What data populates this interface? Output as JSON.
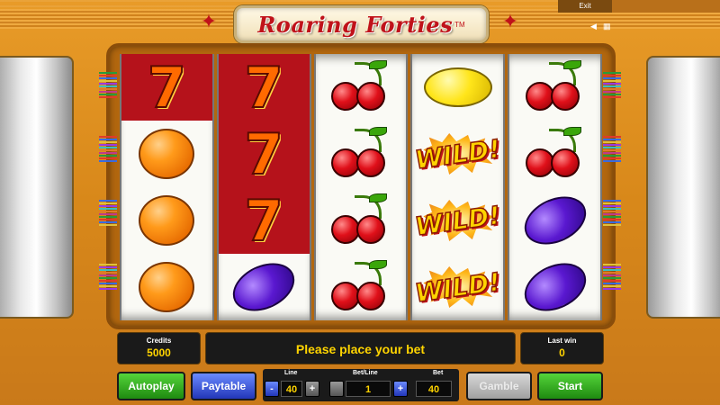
{
  "header": {
    "logo_text": "Roaring Forties",
    "trademark": "TM",
    "exit_label": "Exit"
  },
  "reels": [
    [
      "seven",
      "orange",
      "orange",
      "orange"
    ],
    [
      "seven",
      "seven",
      "seven",
      "plum"
    ],
    [
      "cherries",
      "cherries",
      "cherries",
      "cherries"
    ],
    [
      "lemon",
      "wild",
      "wild",
      "wild"
    ],
    [
      "cherries",
      "cherries",
      "plum",
      "plum"
    ]
  ],
  "symbols": {
    "wild_text": "WILD!"
  },
  "info": {
    "credits_label": "Credits",
    "credits_value": "5000",
    "message": "Please place your bet",
    "last_win_label": "Last win",
    "last_win_value": "0"
  },
  "controls": {
    "autoplay_label": "Autoplay",
    "paytable_label": "Paytable",
    "line_label": "Line",
    "line_value": "40",
    "line_minus": "-",
    "line_plus": "+",
    "bet_line_label": "Bet/Line",
    "bet_line_value": "1",
    "bet_line_plus": "+",
    "bet_label": "Bet",
    "bet_value": "40",
    "gamble_label": "Gamble",
    "start_label": "Start"
  },
  "colors": {
    "background": "#d98f1e",
    "accent_red": "#c0121a",
    "value_yellow": "#ffd400",
    "button_green": "#1e8a10",
    "button_blue": "#2236b8"
  },
  "icons": [
    "sound-icon",
    "fullscreen-icon",
    "star-icon"
  ]
}
